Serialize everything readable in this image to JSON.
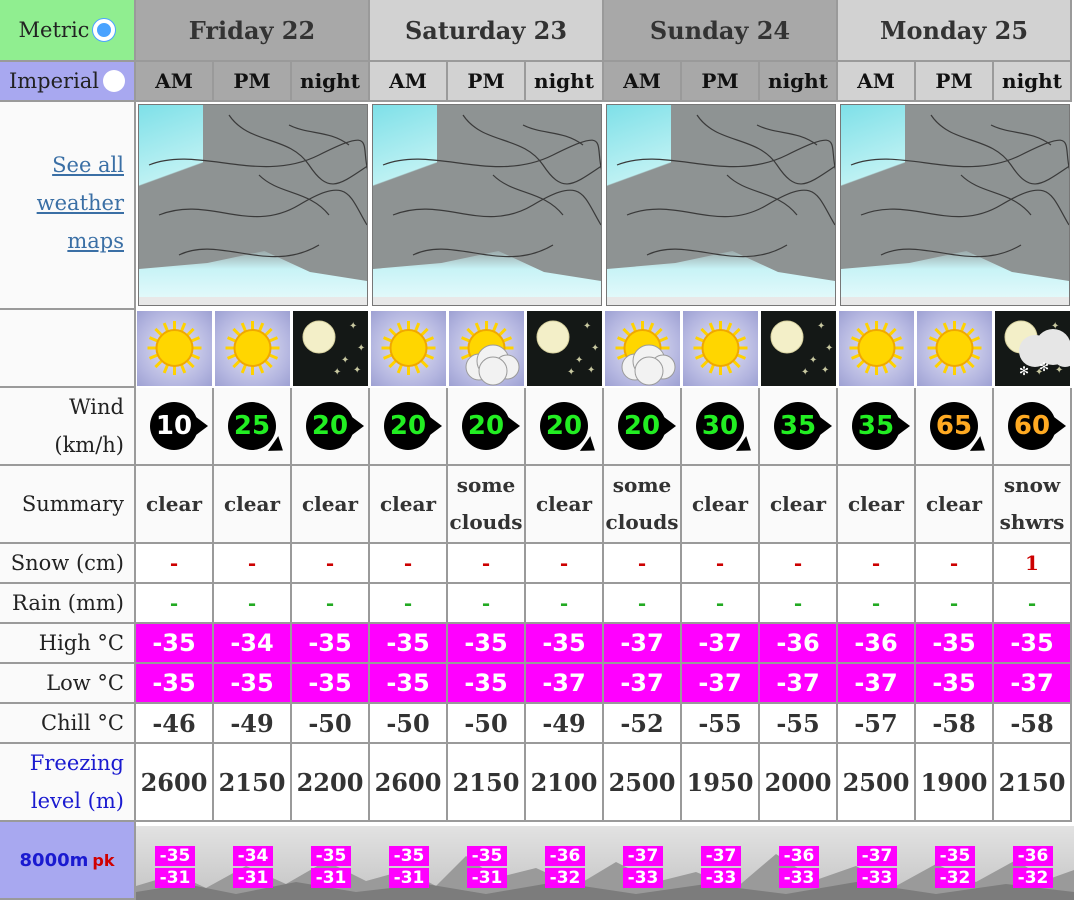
{
  "units": {
    "metric_label": "Metric",
    "imperial_label": "Imperial",
    "selected": "metric"
  },
  "days": [
    {
      "label": "Friday 22"
    },
    {
      "label": "Saturday 23"
    },
    {
      "label": "Sunday 24"
    },
    {
      "label": "Monday 25"
    }
  ],
  "periods": [
    "AM",
    "PM",
    "night",
    "AM",
    "PM",
    "night",
    "AM",
    "PM",
    "night",
    "AM",
    "PM",
    "night"
  ],
  "maps_link": {
    "line1": "See all",
    "line2": "weather",
    "line3": "maps"
  },
  "row_labels": {
    "wind_line1": "Wind",
    "wind_line2": "(km/h)",
    "summary": "Summary",
    "snow": "Snow (cm)",
    "rain": "Rain (mm)",
    "high": "High °C",
    "low": "Low °C",
    "chill": "Chill °C",
    "freezing_line1": "Freezing",
    "freezing_line2": "level (m)",
    "peak": "8000m",
    "peak_sup": "pk"
  },
  "weather_icons": [
    "sun-icon",
    "sun-icon",
    "moon-icon",
    "sun-icon",
    "sun-cloud-icon",
    "moon-icon",
    "sun-cloud-icon",
    "sun-icon",
    "moon-icon",
    "sun-icon",
    "sun-icon",
    "moon-snow-icon"
  ],
  "wind": [
    {
      "speed": "10",
      "color": "#ffffff"
    },
    {
      "speed": "25",
      "color": "#22ee22"
    },
    {
      "speed": "20",
      "color": "#22ee22"
    },
    {
      "speed": "20",
      "color": "#22ee22"
    },
    {
      "speed": "20",
      "color": "#22ee22"
    },
    {
      "speed": "20",
      "color": "#22ee22"
    },
    {
      "speed": "20",
      "color": "#22ee22"
    },
    {
      "speed": "30",
      "color": "#22ee22"
    },
    {
      "speed": "35",
      "color": "#22ee22"
    },
    {
      "speed": "35",
      "color": "#22ee22"
    },
    {
      "speed": "65",
      "color": "#ffaa22"
    },
    {
      "speed": "60",
      "color": "#ffaa22"
    }
  ],
  "summary": [
    [
      "clear"
    ],
    [
      "clear"
    ],
    [
      "clear"
    ],
    [
      "clear"
    ],
    [
      "some",
      "clouds"
    ],
    [
      "clear"
    ],
    [
      "some",
      "clouds"
    ],
    [
      "clear"
    ],
    [
      "clear"
    ],
    [
      "clear"
    ],
    [
      "clear"
    ],
    [
      "snow",
      "shwrs"
    ]
  ],
  "snow": [
    "-",
    "-",
    "-",
    "-",
    "-",
    "-",
    "-",
    "-",
    "-",
    "-",
    "-",
    "1"
  ],
  "rain": [
    "-",
    "-",
    "-",
    "-",
    "-",
    "-",
    "-",
    "-",
    "-",
    "-",
    "-",
    "-"
  ],
  "high": [
    "-35",
    "-34",
    "-35",
    "-35",
    "-35",
    "-35",
    "-37",
    "-37",
    "-36",
    "-36",
    "-35",
    "-35"
  ],
  "low": [
    "-35",
    "-35",
    "-35",
    "-35",
    "-35",
    "-37",
    "-37",
    "-37",
    "-37",
    "-37",
    "-35",
    "-37"
  ],
  "chill": [
    "-46",
    "-49",
    "-50",
    "-50",
    "-50",
    "-49",
    "-52",
    "-55",
    "-55",
    "-57",
    "-58",
    "-58"
  ],
  "freezing": [
    "2600",
    "2150",
    "2200",
    "2600",
    "2150",
    "2100",
    "2500",
    "1950",
    "2000",
    "2500",
    "1900",
    "2150"
  ],
  "peak_high": [
    "-35",
    "-34",
    "-35",
    "-35",
    "-35",
    "-36",
    "-37",
    "-37",
    "-36",
    "-37",
    "-35",
    "-36"
  ],
  "peak_low": [
    "-31",
    "-31",
    "-31",
    "-31",
    "-31",
    "-32",
    "-33",
    "-33",
    "-33",
    "-33",
    "-32",
    "-32"
  ],
  "colors": {
    "metric_bg": "#90ee90",
    "imperial_bg": "#a8a8f0",
    "temp_bg": "#ff00ff",
    "header_dark": "#a8a8a8",
    "header_light": "#d2d2d2",
    "link": "#3a6fa5",
    "freezing_label": "#1a1ad0"
  }
}
